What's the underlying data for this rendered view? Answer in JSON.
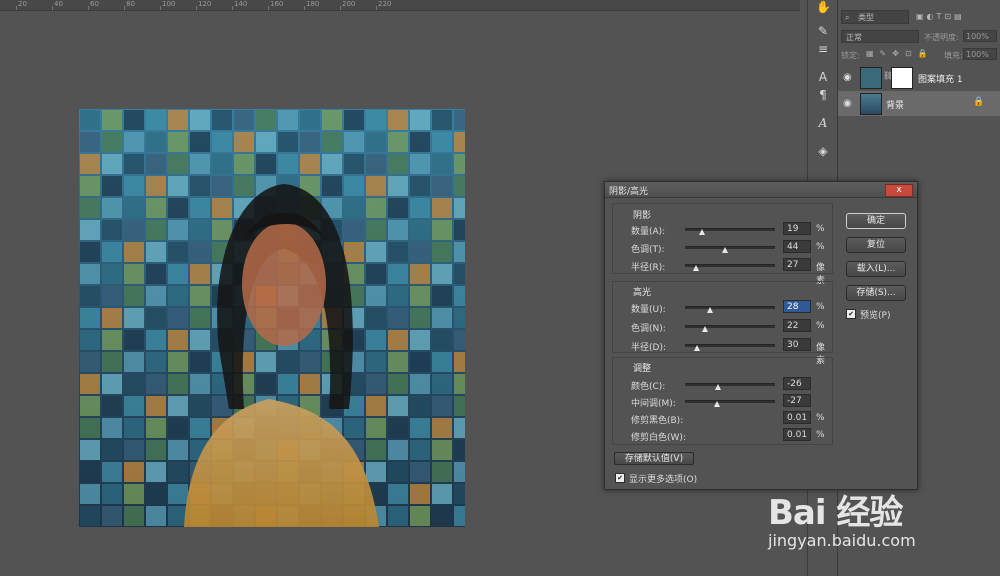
{
  "ruler": {
    "ticks": [
      "20",
      "40",
      "60",
      "80",
      "100",
      "120",
      "140",
      "160",
      "180",
      "200",
      "220"
    ]
  },
  "tools": {
    "icons": [
      "hand-icon",
      "brush-icon",
      "adjust-icon",
      "character-icon",
      "paragraph-icon",
      "glyph-icon",
      "cube-icon"
    ]
  },
  "layers_panel": {
    "kind_filter": "类型",
    "blend_mode": "正常",
    "opacity_label": "不透明度:",
    "opacity_value": "100%",
    "lock_label": "锁定:",
    "fill_label": "填充:",
    "fill_value": "100%",
    "layers": [
      {
        "name": "图案填充 1",
        "selected": false
      },
      {
        "name": "背景",
        "selected": true,
        "locked": true
      }
    ]
  },
  "dialog": {
    "title": "阴影/高光",
    "close_label": "x",
    "shadows": {
      "title": "阴影",
      "rows": [
        {
          "label": "数量(A):",
          "value": "19",
          "unit": "%",
          "pos": 0.19
        },
        {
          "label": "色调(T):",
          "value": "44",
          "unit": "%",
          "pos": 0.44
        },
        {
          "label": "半径(R):",
          "value": "27",
          "unit": "像素",
          "pos": 0.12
        }
      ]
    },
    "highlights": {
      "title": "高光",
      "rows": [
        {
          "label": "数量(U):",
          "value": "28",
          "unit": "%",
          "pos": 0.28,
          "active": true
        },
        {
          "label": "色调(N):",
          "value": "22",
          "unit": "%",
          "pos": 0.22
        },
        {
          "label": "半径(D):",
          "value": "30",
          "unit": "像素",
          "pos": 0.13
        }
      ]
    },
    "adjustments": {
      "title": "调整",
      "rows": [
        {
          "label": "颜色(C):",
          "value": "-26",
          "unit": "",
          "pos": 0.37
        },
        {
          "label": "中间调(M):",
          "value": "-27",
          "unit": "",
          "pos": 0.36
        },
        {
          "label": "修剪黑色(B):",
          "value": "0.01",
          "unit": "%",
          "pos": -1
        },
        {
          "label": "修剪白色(W):",
          "value": "0.01",
          "unit": "%",
          "pos": -1
        }
      ]
    },
    "buttons": {
      "ok": "确定",
      "reset": "复位",
      "load": "载入(L)...",
      "save": "存储(S)...",
      "preview": "预览(P)",
      "save_default": "存储默认值(V)",
      "show_more": "显示更多选项(O)"
    }
  },
  "watermark": {
    "logo": "Bai 经验",
    "url": "jingyan.baidu.com"
  }
}
